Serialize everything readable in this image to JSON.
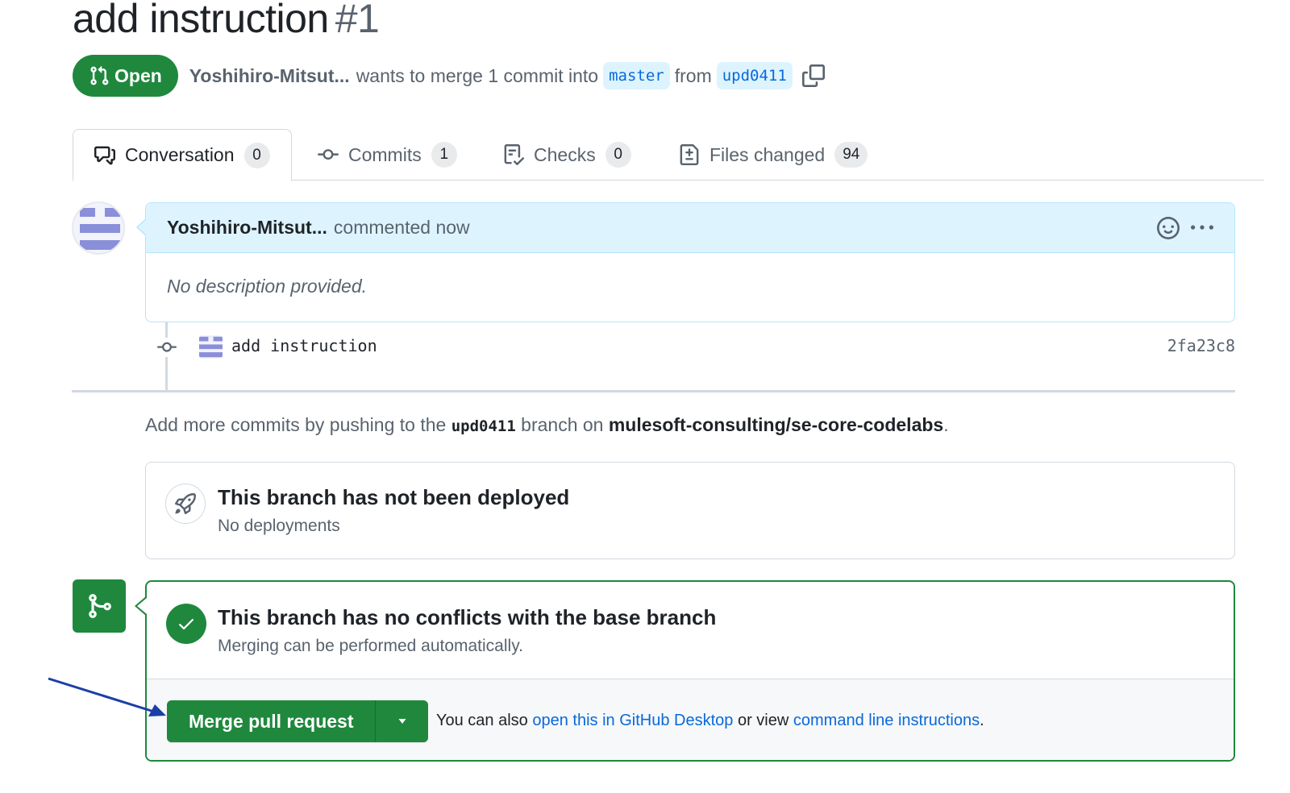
{
  "pr": {
    "title": "add instruction",
    "number": "#1",
    "state": "Open",
    "author": "Yoshihiro-Mitsut...",
    "merge_text": "wants to merge 1 commit into",
    "base_branch": "master",
    "from_text": "from",
    "head_branch": "upd0411"
  },
  "tabs": [
    {
      "label": "Conversation",
      "count": "0",
      "icon": "comment-discussion-icon"
    },
    {
      "label": "Commits",
      "count": "1",
      "icon": "git-commit-icon"
    },
    {
      "label": "Checks",
      "count": "0",
      "icon": "checklist-icon"
    },
    {
      "label": "Files changed",
      "count": "94",
      "icon": "file-diff-icon"
    }
  ],
  "comment": {
    "author": "Yoshihiro-Mitsut...",
    "action": "commented now",
    "body": "No description provided."
  },
  "commit": {
    "message": "add instruction",
    "sha": "2fa23c8"
  },
  "hint": {
    "prefix": "Add more commits by pushing to the",
    "branch": "upd0411",
    "middle": "branch on",
    "repo": "mulesoft-consulting/se-core-codelabs",
    "suffix": "."
  },
  "deploy": {
    "title": "This branch has not been deployed",
    "subtitle": "No deployments"
  },
  "merge": {
    "title": "This branch has no conflicts with the base branch",
    "subtitle": "Merging can be performed automatically.",
    "button": "Merge pull request",
    "also_prefix": "You can also",
    "desktop_link": "open this in GitHub Desktop",
    "or_view": "or view",
    "cli_link": "command line instructions",
    "end": "."
  },
  "colors": {
    "green": "#1f883d",
    "link": "#0969da",
    "comment_header": "#ddf4ff",
    "annotation_arrow": "#1a3fa6"
  }
}
